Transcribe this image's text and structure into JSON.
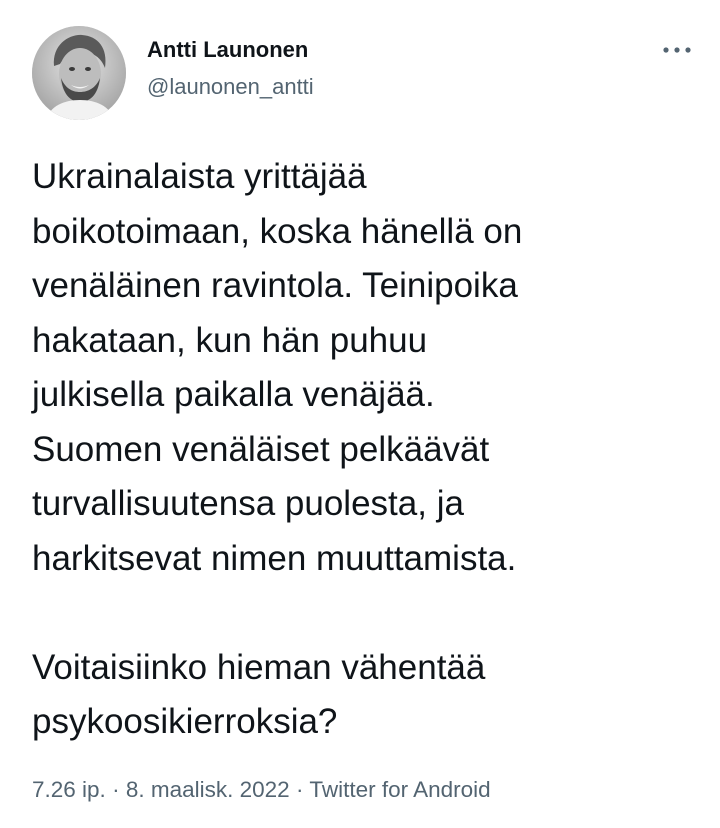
{
  "author": {
    "display_name": "Antti Launonen",
    "handle": "@launonen_antti",
    "avatar_icon": "profile-photo"
  },
  "menu": {
    "icon": "more-horizontal-icon"
  },
  "tweet": {
    "text": "Ukrainalaista yrittäjää\nboikotoimaan, koska hänellä on\nvenäläinen ravintola. Teinipoika\nhakataan, kun hän puhuu\njulkisella paikalla venäjää.\nSuomen venäläiset pelkäävät\nturvallisuutensa puolesta, ja\nharkitsevat nimen muuttamista.\n\nVoitaisiinko hieman vähentää\npsykoosikierroksia?"
  },
  "meta": {
    "time": "7.26 ip.",
    "separator": "·",
    "date": "8. maalisk. 2022",
    "source": "Twitter for Android"
  },
  "colors": {
    "text": "#0f1419",
    "secondary": "#536471",
    "background": "#ffffff"
  }
}
